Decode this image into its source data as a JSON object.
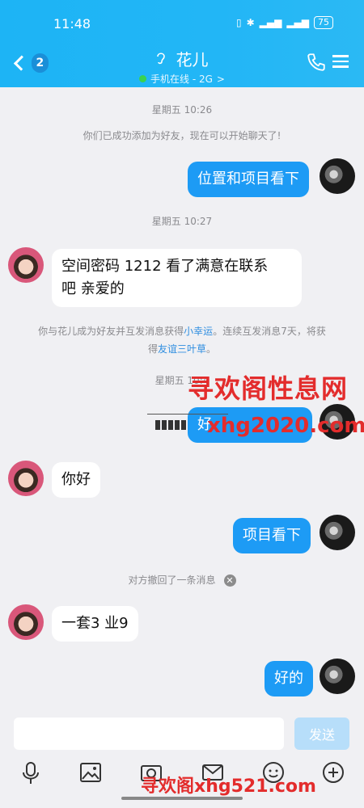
{
  "status_bar": {
    "time": "11:48",
    "battery": "75"
  },
  "header": {
    "back_count": "2",
    "title": "花儿",
    "subtitle": "手机在线 - 2G",
    "subtitle_arrow": ">"
  },
  "chat": {
    "timestamps": [
      "星期五 10:26",
      "星期五 10:27",
      "星期五 10:4"
    ],
    "system_added": "你们已成功添加为好友，现在可以开始聊天了!",
    "system_lucky": {
      "part1": "你与花儿成为好友并互发消息获得",
      "link1": "小幸运",
      "part2": "。连续互发消息7天，将获",
      "part3": "得",
      "link2": "友谊三叶草",
      "part4": "。"
    },
    "system_recall": "对方撤回了一条消息",
    "messages": [
      {
        "from": "me",
        "text": "位置和项目看下"
      },
      {
        "from": "her",
        "line1": "空间密码  1212   看了满意在联系",
        "line2": "吧  亲爱的"
      },
      {
        "from": "me",
        "text": "好"
      },
      {
        "from": "her",
        "text": "你好"
      },
      {
        "from": "me",
        "text": "项目看下"
      },
      {
        "from": "her",
        "text": "一套3  业9"
      },
      {
        "from": "me",
        "text": "好的"
      }
    ]
  },
  "watermark": {
    "line1": "寻欢阁性息网",
    "line2": "xhg2020.com",
    "line3": "寻欢阁xhg521.com"
  },
  "input_bar": {
    "placeholder": "",
    "send_label": "发送",
    "tools": [
      "microphone-icon",
      "image-icon",
      "camera-icon",
      "envelope-icon",
      "emoji-icon",
      "plus-icon"
    ]
  },
  "colors": {
    "header": "#22b6f6",
    "outgoing_bubble": "#1d9bf5",
    "link": "#2f8ee0",
    "watermark": "#e32c2c"
  }
}
